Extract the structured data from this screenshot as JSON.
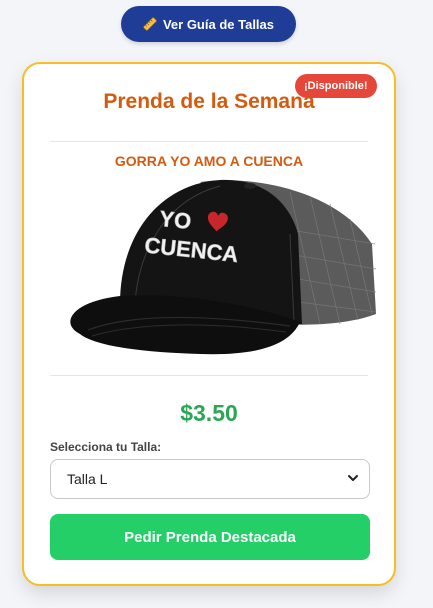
{
  "header": {
    "guide_button_label": "Ver Guía de Tallas",
    "guide_button_icon": "ruler-icon"
  },
  "card": {
    "badge": "¡Disponible!",
    "title": "Prenda de la Semana",
    "product_name": "GORRA YO AMO A CUENCA",
    "image": {
      "text_line1": "YO",
      "text_line2": "CUENCA",
      "heart_icon": "heart-icon"
    },
    "price": "$3.50",
    "size_label": "Selecciona tu Talla:",
    "size_selected": "Talla L",
    "order_button_label": "Pedir Prenda Destacada"
  },
  "colors": {
    "primary_blue": "#1f3c96",
    "border_gold": "#f5be25",
    "title_orange": "#d35b0f",
    "badge_red": "#e5483b",
    "price_green": "#2aa655",
    "button_green": "#24cf68"
  }
}
